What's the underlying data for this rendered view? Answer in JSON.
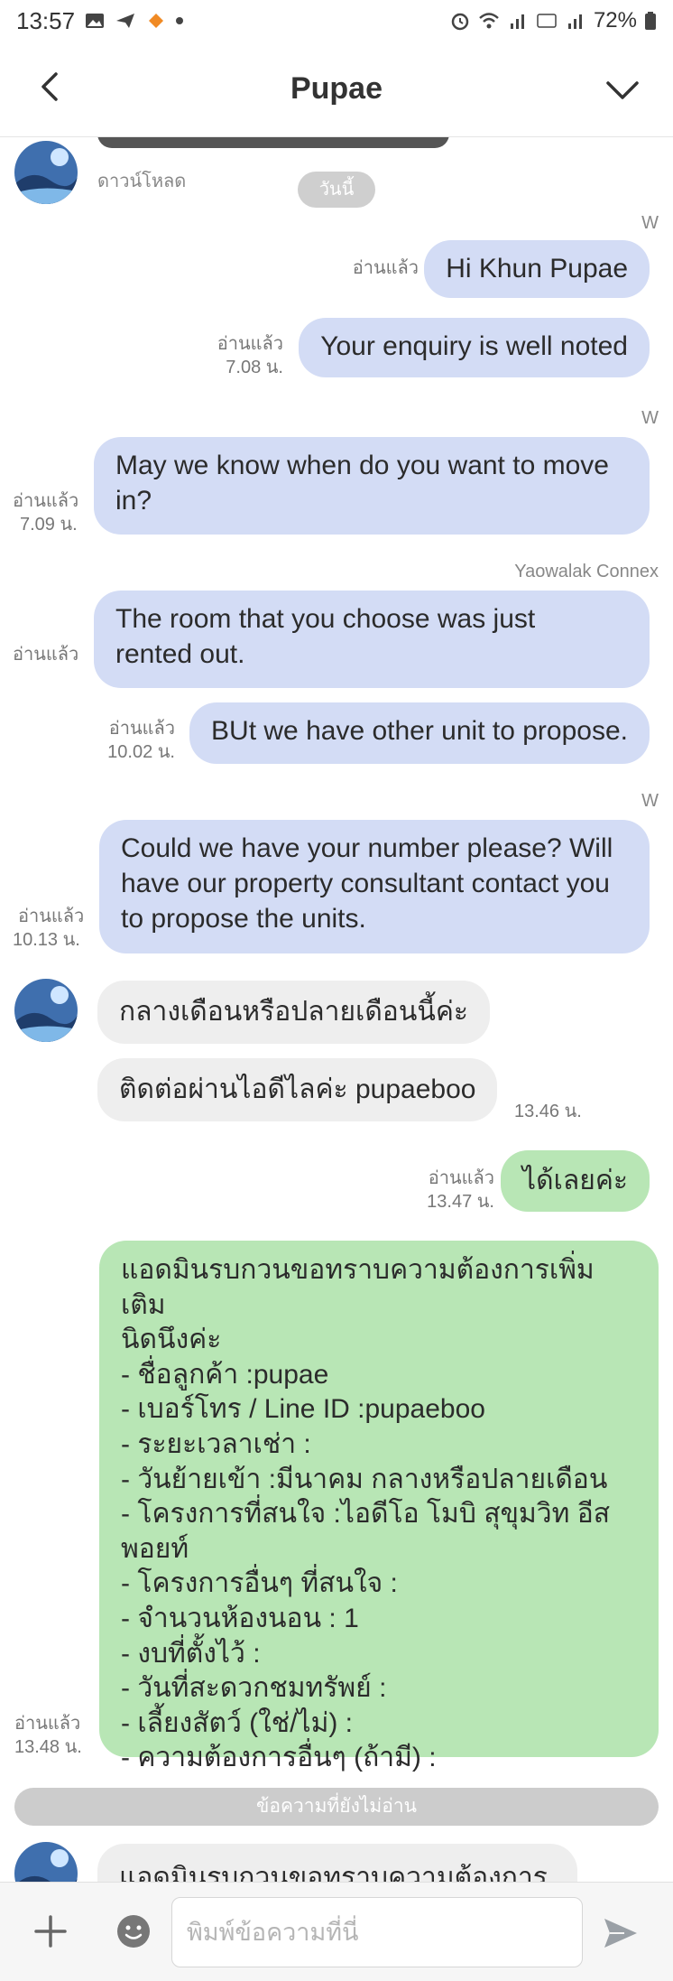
{
  "status_bar": {
    "time": "13:57",
    "battery": "72%"
  },
  "header": {
    "title": "Pupae"
  },
  "chat": {
    "date_divider": "วันนี้",
    "top_partial": {
      "download_label": "ดาวน์โหลด"
    },
    "messages": [
      {
        "sender": "W",
        "text": "Hi Khun Pupae",
        "read": "อ่านแล้ว"
      },
      {
        "text": "Your enquiry is well noted",
        "read": "อ่านแล้ว",
        "time": "7.08 น."
      },
      {
        "sender": "W",
        "text": "May we know when do you want to move in?",
        "read": "อ่านแล้ว",
        "time": "7.09 น."
      },
      {
        "sender": "Yaowalak Connex",
        "text": "The room that you choose was just rented out.",
        "read": "อ่านแล้ว"
      },
      {
        "text": "BUt we have other unit to propose.",
        "read": "อ่านแล้ว",
        "time": "10.02 น."
      },
      {
        "sender": "W",
        "text": "Could we have your number please? Will have our property consultant contact you to propose the units.",
        "read": "อ่านแล้ว",
        "time": "10.13 น."
      },
      {
        "text": "กลางเดือนหรือปลายเดือนนี้ค่ะ"
      },
      {
        "text": "ติดต่อผ่านไอดีไลค่ะ pupaeboo",
        "time": "13.46 น."
      },
      {
        "text": "ได้เลยค่ะ",
        "read": "อ่านแล้ว",
        "time": "13.47 น."
      },
      {
        "lines": [
          "แอดมินรบกวนขอทราบความต้องการเพิ่มเติม",
          "นิดนึงค่ะ",
          "- ชื่อลูกค้า :pupae",
          "- เบอร์โทร / Line ID :pupaeboo",
          "- ระยะเวลาเช่า :",
          "- วันย้ายเข้า :มีนาคม กลางหรือปลายเดือน",
          "- โครงการที่สนใจ :ไอดีโอ โมบิ สุขุมวิท อีส",
          "พอยท์",
          "- โครงการอื่นๆ ที่สนใจ :",
          "- จำนวนห้องนอน : 1",
          "- งบที่ตั้งไว้ :",
          "- วันที่สะดวกชมทรัพย์ :",
          "- เลี้ยงสัตว์ (ใช่/ไม่) :",
          "- ความต้องการอื่นๆ (ถ้ามี) :"
        ],
        "read": "อ่านแล้ว",
        "time": "13.48 น."
      }
    ],
    "unread_divider": "ข้อความที่ยังไม่อ่าน",
    "last_partial": {
      "text": "แอดมินรบกวนขอทราบความต้องการ"
    }
  },
  "input": {
    "placeholder": "พิมพ์ข้อความที่นี่"
  },
  "colors": {
    "outgoing_blue": "#d3dcf5",
    "outgoing_green": "#b8e6b5",
    "incoming_grey": "#eeeeee",
    "send_icon": "#9aa0a6"
  },
  "icons": [
    "back-icon",
    "chevron-down-icon",
    "plus-icon",
    "emoji-icon",
    "send-icon"
  ]
}
